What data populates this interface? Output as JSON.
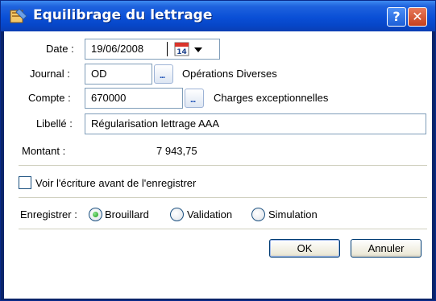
{
  "window": {
    "title": "Equilibrage du lettrage",
    "help_glyph": "?",
    "close_glyph": "✕"
  },
  "form": {
    "date": {
      "label": "Date :",
      "value": "19/06/2008",
      "calendar_day": "14"
    },
    "journal": {
      "label": "Journal :",
      "value": "OD",
      "description": "Opérations Diverses"
    },
    "compte": {
      "label": "Compte :",
      "value": "670000",
      "description": "Charges exceptionnelles"
    },
    "libelle": {
      "label": "Libellé :",
      "value": "Régularisation lettrage AAA"
    },
    "montant": {
      "label": "Montant :",
      "value": "7 943,75"
    },
    "preview_checkbox": {
      "label": "Voir l'écriture avant de l'enregistrer",
      "checked": false
    },
    "enregistrer": {
      "label": "Enregistrer :",
      "options": [
        "Brouillard",
        "Validation",
        "Simulation"
      ],
      "selected": "Brouillard"
    }
  },
  "buttons": {
    "ok": "OK",
    "cancel": "Annuler",
    "browse": "..."
  },
  "colors": {
    "titlebar": "#0a4fd6",
    "frame": "#0a246a",
    "close": "#c4401e",
    "field_border": "#7f9db9"
  }
}
